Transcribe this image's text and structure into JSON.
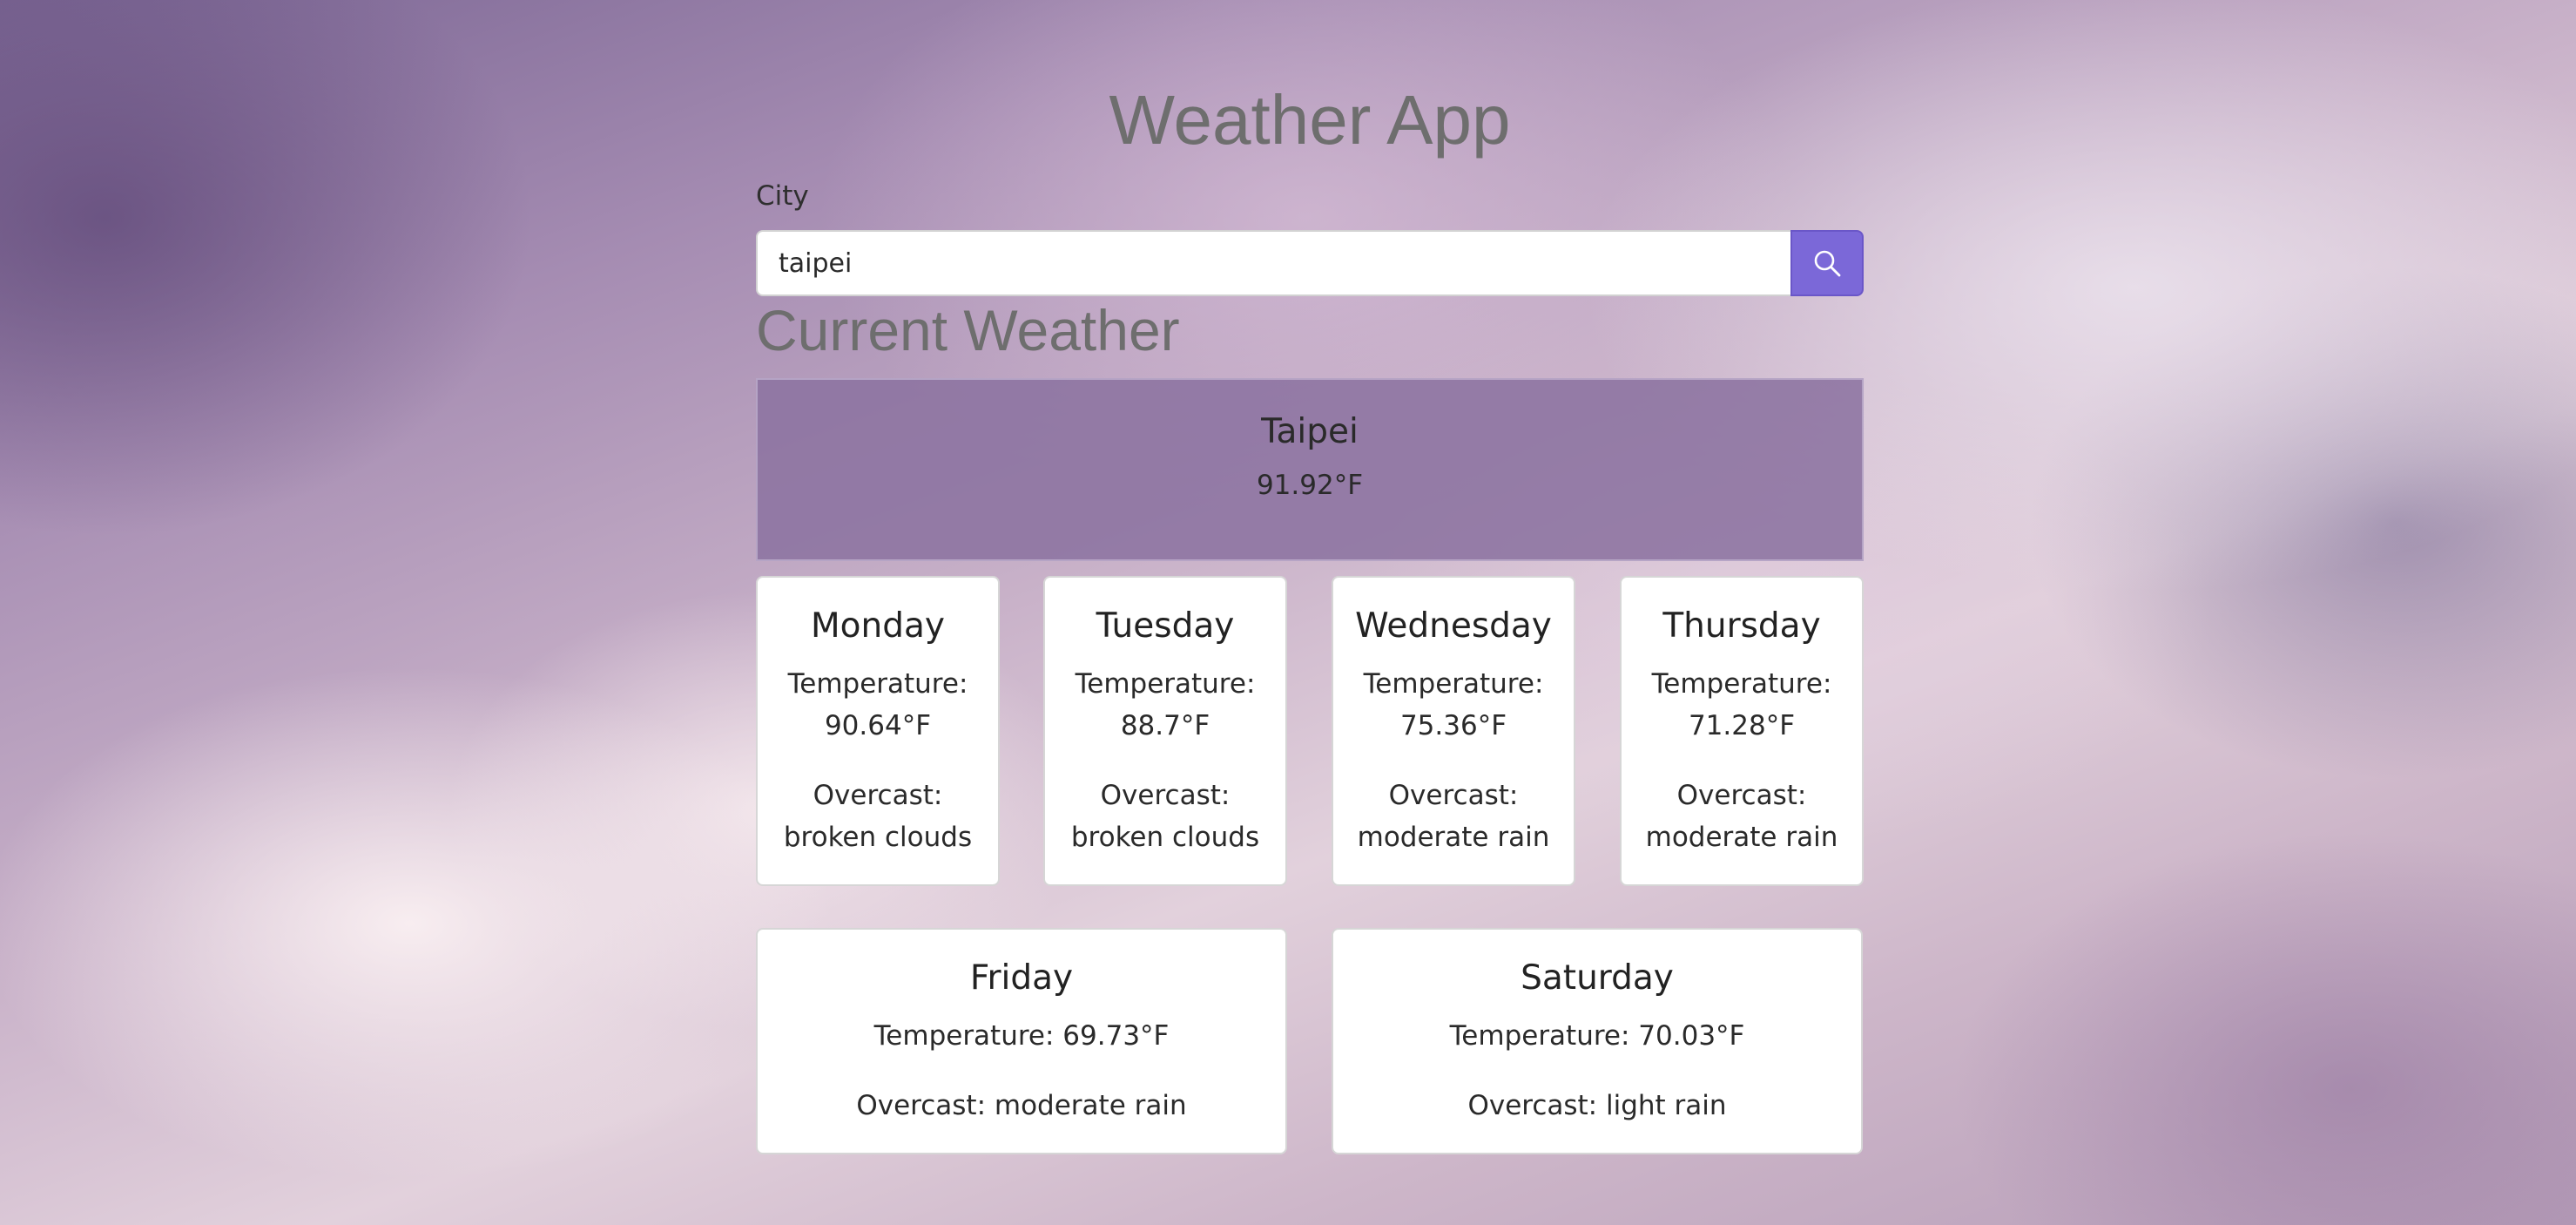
{
  "app": {
    "title": "Weather App"
  },
  "search": {
    "label": "City",
    "value": "taipei",
    "button_icon": "search-icon"
  },
  "current": {
    "section_title": "Current Weather",
    "city": "Taipei",
    "temperature": "91.92°F"
  },
  "forecast": [
    {
      "day": "Monday",
      "temp_label": "Temperature:",
      "temp_value": "90.64°F",
      "overcast_label": "Overcast:",
      "overcast_value": "broken clouds"
    },
    {
      "day": "Tuesday",
      "temp_label": "Temperature:",
      "temp_value": "88.7°F",
      "overcast_label": "Overcast:",
      "overcast_value": "broken clouds"
    },
    {
      "day": "Wednesday",
      "temp_label": "Temperature:",
      "temp_value": "75.36°F",
      "overcast_label": "Overcast:",
      "overcast_value": "moderate rain"
    },
    {
      "day": "Thursday",
      "temp_label": "Temperature:",
      "temp_value": "71.28°F",
      "overcast_label": "Overcast:",
      "overcast_value": "moderate rain"
    },
    {
      "day": "Friday",
      "temp_text": "Temperature: 69.73°F",
      "overcast_text": "Overcast: moderate rain"
    },
    {
      "day": "Saturday",
      "temp_text": "Temperature: 70.03°F",
      "overcast_text": "Overcast: light rain"
    }
  ],
  "colors": {
    "accent": "#7b68d8",
    "current_card": "#8c73a0",
    "heading": "#6e6e6e"
  }
}
